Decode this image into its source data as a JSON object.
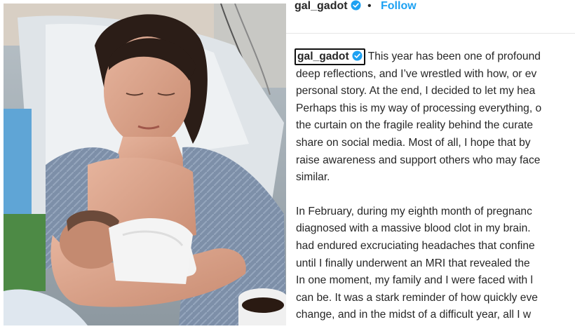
{
  "post": {
    "username": "gal_gadot",
    "separator": "•",
    "follow_label": "Follow"
  },
  "caption": {
    "username": "gal_gadot",
    "para1_line1": "This year has been one of profound",
    "para1_lines": [
      "deep reflections, and I’ve wrestled with how, or ev",
      "personal story. At the end, I decided to let my hea",
      "Perhaps this is my way of processing everything, o",
      "the curtain on the fragile reality behind the curate",
      "share on social media. Most of all, I hope that by",
      "raise awareness and support others who may face",
      "similar."
    ],
    "para2_lines": [
      "In February, during my eighth month of pregnanc",
      "diagnosed with a massive blood clot in my brain.",
      "had endured excruciating headaches that confine",
      "until I finally underwent an MRI that revealed the",
      "In one moment, my family and I were faced with l",
      "can be. It was a stark reminder of how quickly eve",
      "change, and in the midst of a difficult year, all I w"
    ]
  },
  "icons": {
    "verified": "verified-badge-icon",
    "verified_color": "#1da1f2"
  },
  "colors": {
    "text": "#262626",
    "link": "#1da1f2"
  }
}
